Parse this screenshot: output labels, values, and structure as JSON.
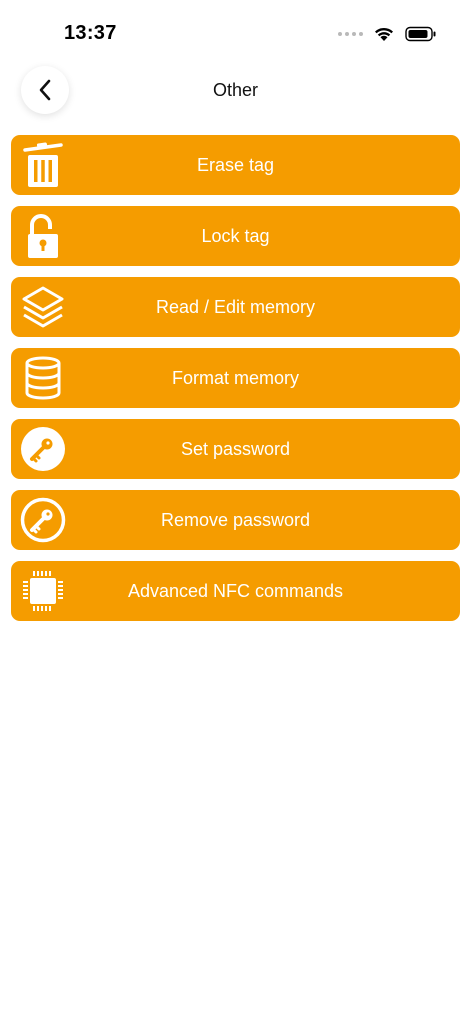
{
  "status_bar": {
    "time": "13:37",
    "icons": [
      "signal-dots-icon",
      "wifi-icon",
      "battery-icon"
    ]
  },
  "nav": {
    "title": "Other",
    "back_icon": "chevron-left-icon"
  },
  "menu": {
    "accent_color": "#f59c00",
    "items": [
      {
        "label": "Erase tag",
        "icon": "trash-icon"
      },
      {
        "label": "Lock tag",
        "icon": "lock-icon"
      },
      {
        "label": "Read / Edit memory",
        "icon": "layers-icon"
      },
      {
        "label": "Format memory",
        "icon": "database-icon"
      },
      {
        "label": "Set password",
        "icon": "key-icon"
      },
      {
        "label": "Remove password",
        "icon": "key-outline-icon"
      },
      {
        "label": "Advanced NFC commands",
        "icon": "chip-icon"
      }
    ]
  }
}
